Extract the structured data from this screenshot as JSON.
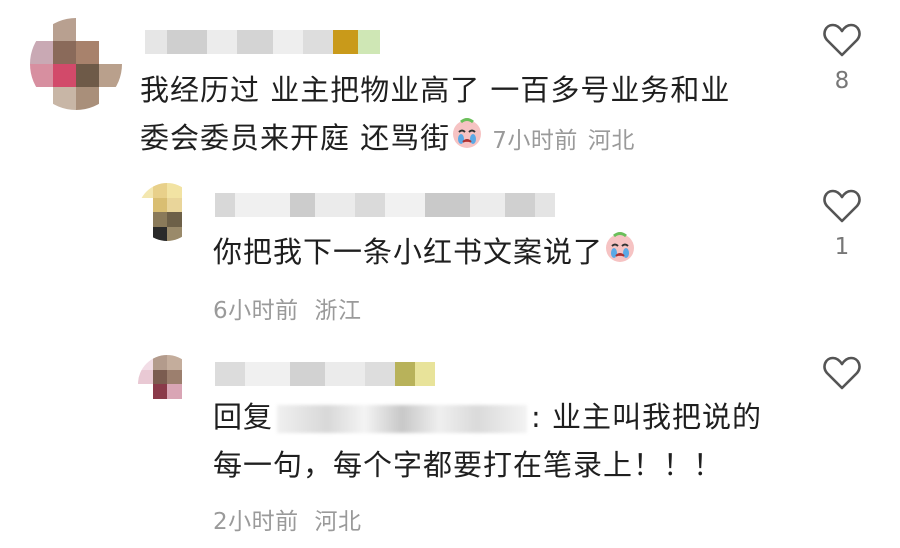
{
  "comments": [
    {
      "text_line1": "我经历过 业主把物业高了  一百多号业务和业",
      "text_line2": "委会委员来开庭 还骂街",
      "time": "7小时前",
      "location": "河北",
      "likes": "8"
    },
    {
      "text": "你把我下一条小红书文案说了",
      "time": "6小时前",
      "location": "浙江",
      "likes": "1"
    },
    {
      "reply_prefix": "回复",
      "text_line1": ": 业主叫我把说的",
      "text_line2": "每一句，每个字都要打在笔录上！！！",
      "time": "2小时前",
      "location": "河北",
      "likes": ""
    }
  ],
  "icons": {
    "like": "heart-outline-icon",
    "emoji": "crying-face-emoji-icon"
  },
  "colors": {
    "text": "#1f1f1f",
    "meta": "#9a9a9a",
    "icon": "#555555"
  }
}
